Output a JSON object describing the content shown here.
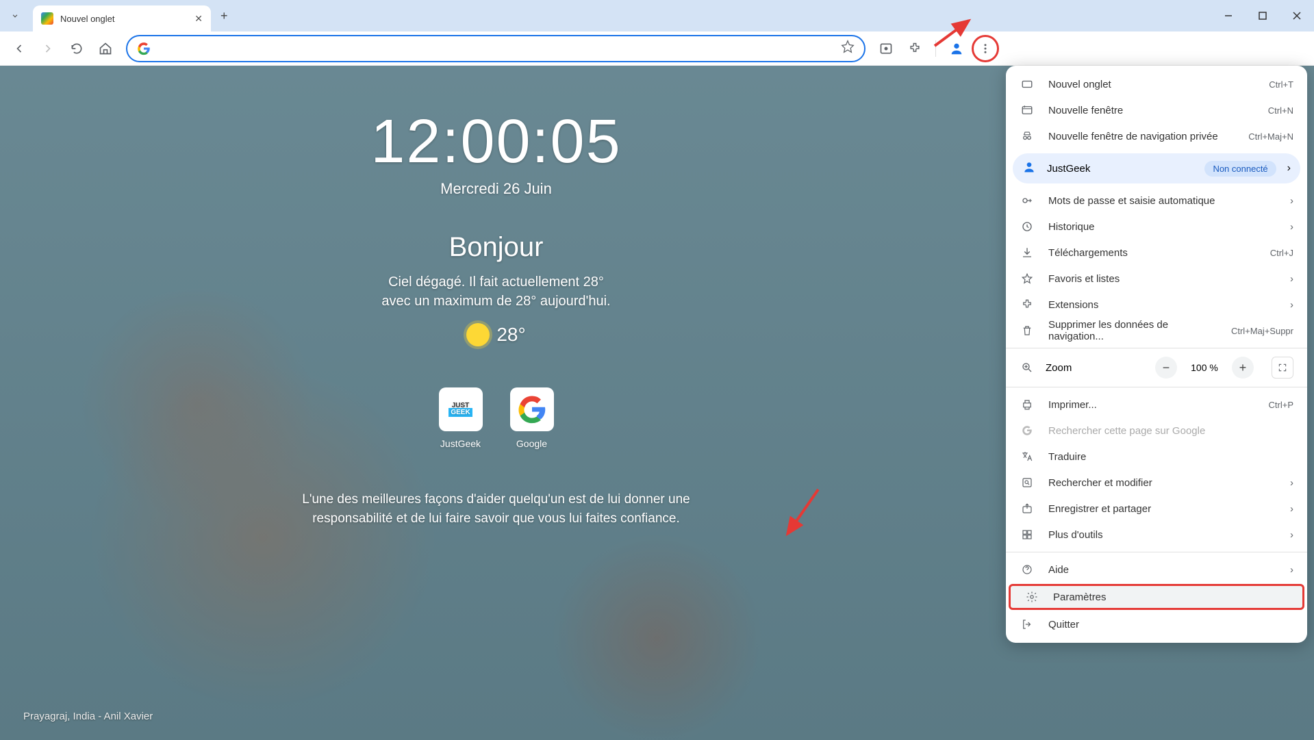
{
  "titlebar": {
    "tab_title": "Nouvel onglet"
  },
  "ntp": {
    "clock": "12:00:05",
    "date": "Mercredi 26 Juin",
    "greeting": "Bonjour",
    "weather_line1": "Ciel dégagé. Il fait actuellement 28°",
    "weather_line2": "avec un maximum de 28° aujourd'hui.",
    "temp": "28°",
    "shortcuts": [
      {
        "label": "JustGeek"
      },
      {
        "label": "Google"
      }
    ],
    "quote": "L'une des meilleures façons d'aider quelqu'un est de lui donner une responsabilité et de lui faire savoir que vous lui faites confiance.",
    "credit": "Prayagraj, India - Anil Xavier"
  },
  "menu": {
    "new_tab": {
      "label": "Nouvel onglet",
      "shortcut": "Ctrl+T"
    },
    "new_window": {
      "label": "Nouvelle fenêtre",
      "shortcut": "Ctrl+N"
    },
    "incognito": {
      "label": "Nouvelle fenêtre de navigation privée",
      "shortcut": "Ctrl+Maj+N"
    },
    "profile": {
      "name": "JustGeek",
      "status": "Non connecté"
    },
    "passwords": {
      "label": "Mots de passe et saisie automatique"
    },
    "history": {
      "label": "Historique"
    },
    "downloads": {
      "label": "Téléchargements",
      "shortcut": "Ctrl+J"
    },
    "bookmarks": {
      "label": "Favoris et listes"
    },
    "extensions": {
      "label": "Extensions"
    },
    "clear_data": {
      "label": "Supprimer les données de navigation...",
      "shortcut": "Ctrl+Maj+Suppr"
    },
    "zoom": {
      "label": "Zoom",
      "value": "100 %"
    },
    "print": {
      "label": "Imprimer...",
      "shortcut": "Ctrl+P"
    },
    "search_google": {
      "label": "Rechercher cette page sur Google"
    },
    "translate": {
      "label": "Traduire"
    },
    "find_edit": {
      "label": "Rechercher et modifier"
    },
    "save_share": {
      "label": "Enregistrer et partager"
    },
    "more_tools": {
      "label": "Plus d'outils"
    },
    "help": {
      "label": "Aide"
    },
    "settings": {
      "label": "Paramètres"
    },
    "quit": {
      "label": "Quitter"
    }
  }
}
